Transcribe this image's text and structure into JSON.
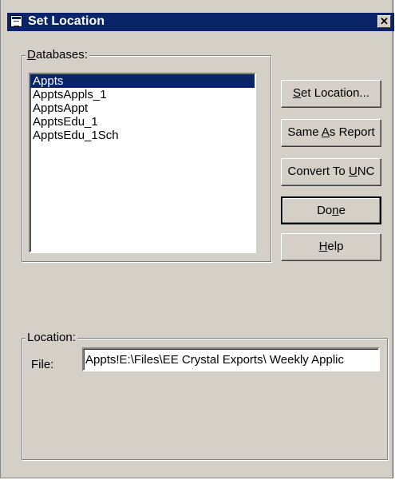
{
  "window": {
    "title": "Set Location",
    "close_glyph": "✕"
  },
  "databases": {
    "label_first": "D",
    "label_rest": "atabases:",
    "items": [
      "Appts",
      "ApptsAppls_1",
      "ApptsAppt",
      "ApptsEdu_1",
      "ApptsEdu_1Sch"
    ],
    "selected": "Appts"
  },
  "buttons": {
    "set_location": {
      "pre": "",
      "key": "S",
      "post": "et Location..."
    },
    "same_as_report": {
      "pre": "Same ",
      "key": "A",
      "post": "s Report"
    },
    "convert_to_unc": {
      "pre": "Convert To ",
      "key": "U",
      "post": "NC"
    },
    "done": {
      "pre": "Do",
      "key": "n",
      "post": "e"
    },
    "help": {
      "pre": "",
      "key": "H",
      "post": "elp"
    }
  },
  "location": {
    "group_label": "Location:",
    "file_label": "File:",
    "file_value": "Appts!E:\\Files\\EE Crystal Exports\\ Weekly Applic"
  },
  "colors": {
    "titlebar": "#0a246a",
    "face": "#d4d0c8",
    "selection": "#0a246a"
  }
}
